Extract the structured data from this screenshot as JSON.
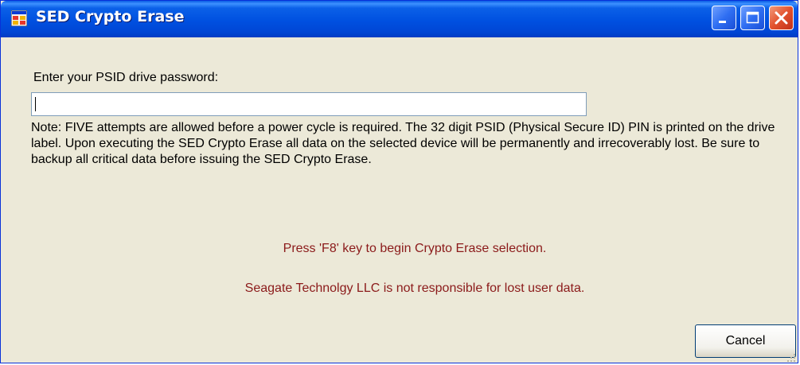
{
  "window": {
    "title": "SED Crypto Erase",
    "titlebar_color": "#0050e0",
    "icon": "app-window-icon",
    "controls": [
      "minimize-icon",
      "maximize-icon",
      "close-icon"
    ]
  },
  "form": {
    "prompt_label": "Enter your PSID drive password:",
    "password_value": "",
    "note": "Note: FIVE attempts are allowed before a power cycle is required.  The 32 digit PSID (Physical Secure ID) PIN is printed on the drive label.  Upon executing the SED Crypto Erase all data on the selected device will be permanently and irrecoverably lost. Be sure to backup all critical data before issuing the SED Crypto Erase."
  },
  "messages": {
    "f8_instruction": "Press 'F8' key to begin Crypto Erase selection.",
    "disclaimer": "Seagate Technolgy LLC is not responsible for lost user data.",
    "color": "#8b1a1a"
  },
  "buttons": {
    "cancel_label": "Cancel"
  }
}
